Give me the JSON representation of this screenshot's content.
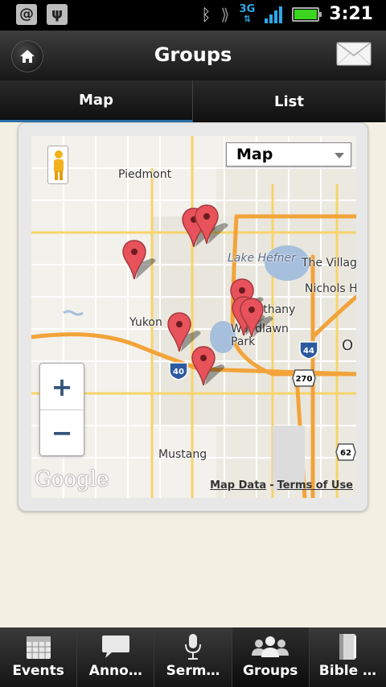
{
  "status_bar": {
    "time": "3:21",
    "network": "3G",
    "icons": [
      "at-icon",
      "usb-icon",
      "bluetooth-icon",
      "signal-icon",
      "battery-icon"
    ]
  },
  "header": {
    "title": "Groups",
    "home_icon": "home-icon",
    "mail_icon": "mail-icon"
  },
  "tabs": [
    {
      "label": "Map",
      "active": true
    },
    {
      "label": "List",
      "active": false
    }
  ],
  "map": {
    "type_selector": "Map",
    "labels": {
      "piedmont": "Piedmont",
      "lake_hefner": "Lake Hefner",
      "the_village": "The Villag",
      "nichols_hills": "Nichols H",
      "yukon": "Yukon",
      "bethany": "Bethany",
      "woodlawn_park": "Woodlawn Park",
      "mustang": "Mustang",
      "okc": "O"
    },
    "highway_shields": [
      "40",
      "44",
      "270",
      "62"
    ],
    "zoom_in": "+",
    "zoom_out": "−",
    "logo": "Google",
    "map_data": "Map Data",
    "separator": "-",
    "terms": "Terms of Use",
    "marker_count": 8
  },
  "bottom_nav": [
    {
      "label": "Events",
      "icon": "calendar-icon"
    },
    {
      "label": "Anno…",
      "icon": "speech-bubble-icon"
    },
    {
      "label": "Serm…",
      "icon": "microphone-icon"
    },
    {
      "label": "Groups",
      "icon": "people-icon",
      "active": true
    },
    {
      "label": "Bible …",
      "icon": "book-icon"
    }
  ],
  "colors": {
    "accent": "#2a6fa8",
    "marker": "#e8525a",
    "battery": "#3bd41e",
    "network": "#2ea8e8"
  }
}
